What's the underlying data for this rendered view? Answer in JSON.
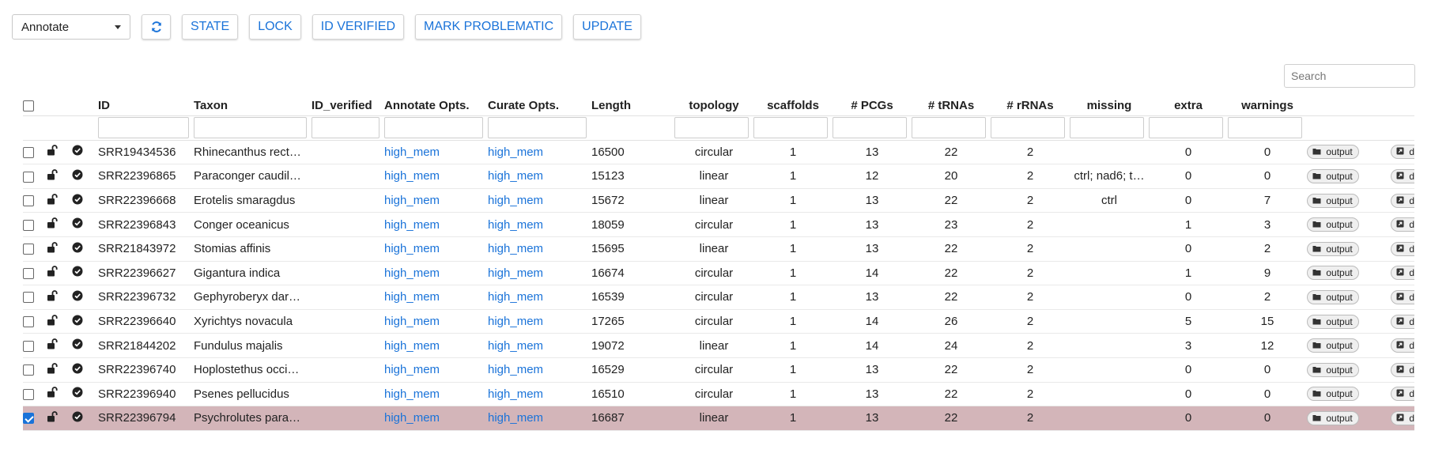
{
  "toolbar": {
    "mode_select": "Annotate",
    "refresh_icon": "refresh-icon",
    "buttons": [
      "STATE",
      "LOCK",
      "ID VERIFIED",
      "MARK PROBLEMATIC",
      "UPDATE"
    ]
  },
  "search": {
    "placeholder": "Search"
  },
  "table": {
    "headers": [
      "ID",
      "Taxon",
      "ID_verified",
      "Annotate Opts.",
      "Curate Opts.",
      "Length",
      "topology",
      "scaffolds",
      "# PCGs",
      "# tRNAs",
      "# rRNAs",
      "missing",
      "extra",
      "warnings"
    ],
    "row_buttons": {
      "output": "output",
      "details": "details"
    },
    "rows": [
      {
        "selected": false,
        "id": "SRR19434536",
        "taxon": "Rhinecanthus rect…",
        "id_verified": "",
        "annotate": "high_mem",
        "curate": "high_mem",
        "length": "16500",
        "topology": "circular",
        "scaffolds": "1",
        "pcgs": "13",
        "trnas": "22",
        "rrnas": "2",
        "missing": "",
        "extra": "0",
        "warnings": "0"
      },
      {
        "selected": false,
        "id": "SRR22396865",
        "taxon": "Paraconger caudil…",
        "id_verified": "",
        "annotate": "high_mem",
        "curate": "high_mem",
        "length": "15123",
        "topology": "linear",
        "scaffolds": "1",
        "pcgs": "12",
        "trnas": "20",
        "rrnas": "2",
        "missing": "ctrl; nad6; t…",
        "extra": "0",
        "warnings": "0"
      },
      {
        "selected": false,
        "id": "SRR22396668",
        "taxon": "Erotelis smaragdus",
        "id_verified": "",
        "annotate": "high_mem",
        "curate": "high_mem",
        "length": "15672",
        "topology": "linear",
        "scaffolds": "1",
        "pcgs": "13",
        "trnas": "22",
        "rrnas": "2",
        "missing": "ctrl",
        "extra": "0",
        "warnings": "7"
      },
      {
        "selected": false,
        "id": "SRR22396843",
        "taxon": "Conger oceanicus",
        "id_verified": "",
        "annotate": "high_mem",
        "curate": "high_mem",
        "length": "18059",
        "topology": "circular",
        "scaffolds": "1",
        "pcgs": "13",
        "trnas": "23",
        "rrnas": "2",
        "missing": "",
        "extra": "1",
        "warnings": "3"
      },
      {
        "selected": false,
        "id": "SRR21843972",
        "taxon": "Stomias affinis",
        "id_verified": "",
        "annotate": "high_mem",
        "curate": "high_mem",
        "length": "15695",
        "topology": "linear",
        "scaffolds": "1",
        "pcgs": "13",
        "trnas": "22",
        "rrnas": "2",
        "missing": "",
        "extra": "0",
        "warnings": "2"
      },
      {
        "selected": false,
        "id": "SRR22396627",
        "taxon": "Gigantura indica",
        "id_verified": "",
        "annotate": "high_mem",
        "curate": "high_mem",
        "length": "16674",
        "topology": "circular",
        "scaffolds": "1",
        "pcgs": "14",
        "trnas": "22",
        "rrnas": "2",
        "missing": "",
        "extra": "1",
        "warnings": "9"
      },
      {
        "selected": false,
        "id": "SRR22396732",
        "taxon": "Gephyroberyx dar…",
        "id_verified": "",
        "annotate": "high_mem",
        "curate": "high_mem",
        "length": "16539",
        "topology": "circular",
        "scaffolds": "1",
        "pcgs": "13",
        "trnas": "22",
        "rrnas": "2",
        "missing": "",
        "extra": "0",
        "warnings": "2"
      },
      {
        "selected": false,
        "id": "SRR22396640",
        "taxon": "Xyrichtys novacula",
        "id_verified": "",
        "annotate": "high_mem",
        "curate": "high_mem",
        "length": "17265",
        "topology": "circular",
        "scaffolds": "1",
        "pcgs": "14",
        "trnas": "26",
        "rrnas": "2",
        "missing": "",
        "extra": "5",
        "warnings": "15"
      },
      {
        "selected": false,
        "id": "SRR21844202",
        "taxon": "Fundulus majalis",
        "id_verified": "",
        "annotate": "high_mem",
        "curate": "high_mem",
        "length": "19072",
        "topology": "linear",
        "scaffolds": "1",
        "pcgs": "14",
        "trnas": "24",
        "rrnas": "2",
        "missing": "",
        "extra": "3",
        "warnings": "12"
      },
      {
        "selected": false,
        "id": "SRR22396740",
        "taxon": "Hoplostethus occi…",
        "id_verified": "",
        "annotate": "high_mem",
        "curate": "high_mem",
        "length": "16529",
        "topology": "circular",
        "scaffolds": "1",
        "pcgs": "13",
        "trnas": "22",
        "rrnas": "2",
        "missing": "",
        "extra": "0",
        "warnings": "0"
      },
      {
        "selected": false,
        "id": "SRR22396940",
        "taxon": "Psenes pellucidus",
        "id_verified": "",
        "annotate": "high_mem",
        "curate": "high_mem",
        "length": "16510",
        "topology": "circular",
        "scaffolds": "1",
        "pcgs": "13",
        "trnas": "22",
        "rrnas": "2",
        "missing": "",
        "extra": "0",
        "warnings": "0"
      },
      {
        "selected": true,
        "id": "SRR22396794",
        "taxon": "Psychrolutes para…",
        "id_verified": "",
        "annotate": "high_mem",
        "curate": "high_mem",
        "length": "16687",
        "topology": "linear",
        "scaffolds": "1",
        "pcgs": "13",
        "trnas": "22",
        "rrnas": "2",
        "missing": "",
        "extra": "0",
        "warnings": "0"
      }
    ]
  },
  "colors": {
    "accent": "#1a73d9",
    "selected_row": "#d3b5b9"
  }
}
